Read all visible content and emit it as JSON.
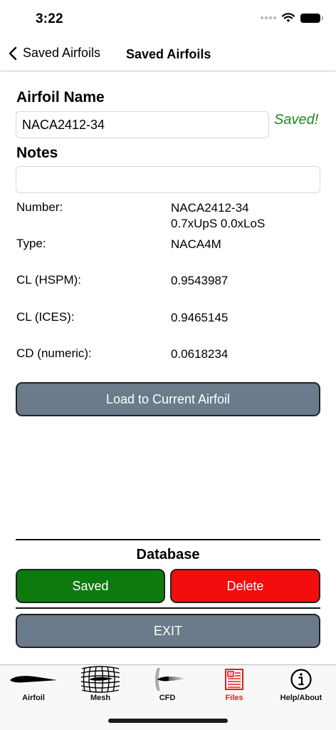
{
  "status_bar": {
    "time": "3:22"
  },
  "nav": {
    "back_label": "Saved Airfoils",
    "title": "Saved Airfoils"
  },
  "form": {
    "airfoil_name_label": "Airfoil Name",
    "airfoil_name_value": "NACA2412-34",
    "saved_indicator": "Saved!",
    "notes_label": "Notes",
    "notes_value": ""
  },
  "info": [
    {
      "label": "Number:",
      "value_line1": "NACA2412-34",
      "value_line2": "0.7xUpS 0.0xLoS"
    },
    {
      "label": "Type:",
      "value_line1": "NACA4M"
    },
    {
      "label": "CL (HSPM):",
      "value_line1": "0.9543987"
    },
    {
      "label": "CL (ICES):",
      "value_line1": "0.9465145"
    },
    {
      "label": "CD (numeric):",
      "value_line1": "0.0618234"
    }
  ],
  "buttons": {
    "load": "Load to Current Airfoil",
    "saved": "Saved",
    "delete": "Delete",
    "exit": "EXIT"
  },
  "database": {
    "title": "Database"
  },
  "tabs": [
    {
      "label": "Airfoil",
      "icon": "airfoil-shape-icon",
      "active": false
    },
    {
      "label": "Mesh",
      "icon": "mesh-grid-icon",
      "active": false
    },
    {
      "label": "CFD",
      "icon": "cfd-flow-icon",
      "active": false
    },
    {
      "label": "Files",
      "icon": "files-document-icon",
      "active": true
    },
    {
      "label": "Help/About",
      "icon": "info-circle-icon",
      "active": false
    }
  ],
  "colors": {
    "saved_text": "#1f8a1f",
    "button_gray": "#6c7b8b",
    "button_green": "#0d7a0d",
    "button_red": "#f40d0d",
    "active_tab": "#e0201c"
  }
}
